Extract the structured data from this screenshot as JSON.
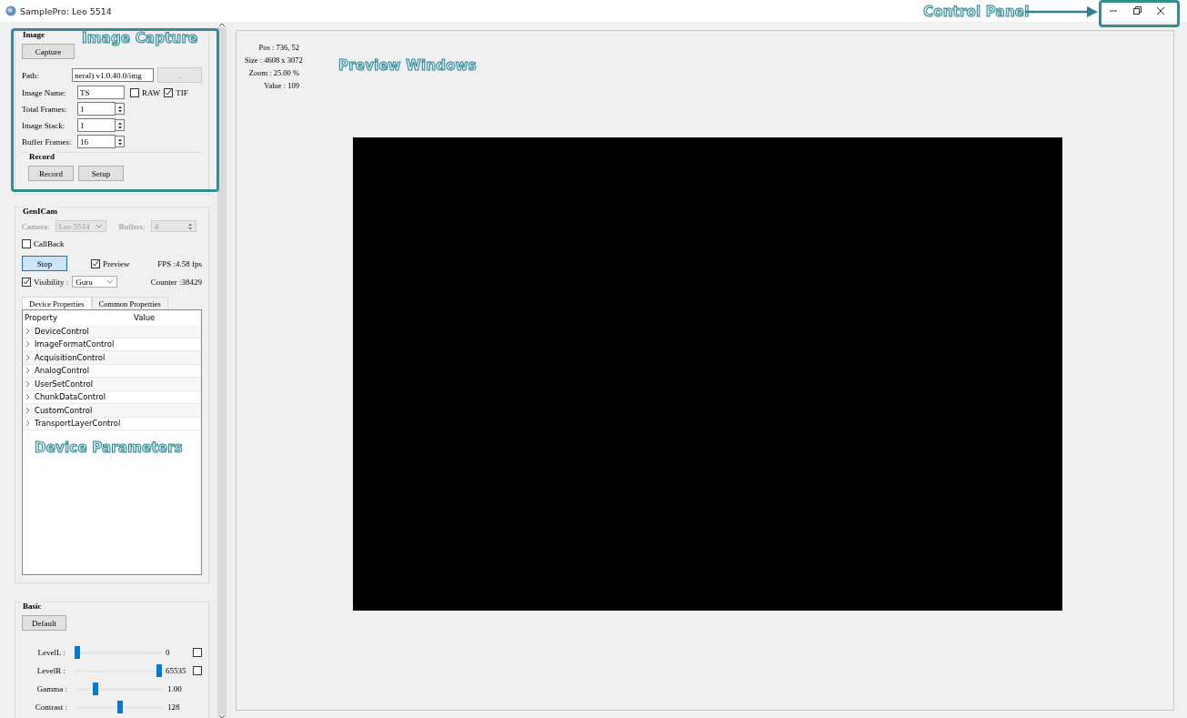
{
  "window": {
    "title": "SamplePro: Leo 5514"
  },
  "image_group": {
    "title": "Image",
    "capture_button": "Capture",
    "path": {
      "label": "Path:",
      "value": "neral) v1.0.40.0/img",
      "browse": "..."
    },
    "image_name": {
      "label": "Image Name:",
      "value": "TS"
    },
    "formats": [
      {
        "label": "RAW",
        "checked": false
      },
      {
        "label": "TIF",
        "checked": true
      }
    ],
    "spinners": [
      {
        "label": "Total Frames:",
        "value": "1"
      },
      {
        "label": "Image Stack:",
        "value": "1"
      },
      {
        "label": "Buffer Frames:",
        "value": "16"
      }
    ]
  },
  "record_group": {
    "title": "Record",
    "buttons": [
      "Record",
      "Setup"
    ]
  },
  "genicam": {
    "title": "GenICam",
    "camera": {
      "label": "Camera:",
      "value": "Leo 5514",
      "disabled": true
    },
    "buffers": {
      "label": "Buffers:",
      "value": "4",
      "disabled": true
    },
    "callback": {
      "label": "CallBack",
      "checked": false
    },
    "stop_button": {
      "label": "Stop",
      "focused": true
    },
    "preview": {
      "label": "Preview",
      "checked": true
    },
    "fps": "FPS :4.58 fps",
    "visibility": {
      "label": "Visibility :",
      "checked": true,
      "value": "Guru"
    },
    "counter": "Counter :38429",
    "tabs": [
      {
        "label": "Device Properties",
        "selected": true
      },
      {
        "label": "Common Properties",
        "selected": false
      }
    ],
    "columns": [
      "Property",
      "Value"
    ],
    "rows": [
      {
        "name": "DeviceControl",
        "expanded": false
      },
      {
        "name": "ImageFormatControl",
        "expanded": false
      },
      {
        "name": "AcquisitionControl",
        "expanded": false
      },
      {
        "name": "AnalogControl",
        "expanded": false
      },
      {
        "name": "UserSetControl",
        "expanded": false
      },
      {
        "name": "ChunkDataControl",
        "expanded": false
      },
      {
        "name": "CustomControl",
        "expanded": false
      },
      {
        "name": "TransportLayerControl",
        "expanded": false
      }
    ]
  },
  "basic": {
    "title": "Basic",
    "default_button": "Default",
    "sliders": [
      {
        "label": "LevelL :",
        "level": 0,
        "reading": "0",
        "checked": false
      },
      {
        "label": "LevelR :",
        "level": 1,
        "reading": "65535",
        "checked": false
      },
      {
        "label": "Gamma :",
        "level": 0.2,
        "reading": "1.00"
      },
      {
        "label": "Contrast :",
        "level": 0.5,
        "reading": "128"
      }
    ]
  },
  "preview": {
    "info": [
      "Pos : 736, 52",
      "Size : 4608 x 3072",
      "Zoom : 25.00 %",
      "Value : 109"
    ]
  },
  "annotations": [
    {
      "text": "Image Capture"
    },
    {
      "text": "Preview Windows"
    },
    {
      "text": "Device Parameters"
    },
    {
      "text": "Control Panel"
    }
  ]
}
